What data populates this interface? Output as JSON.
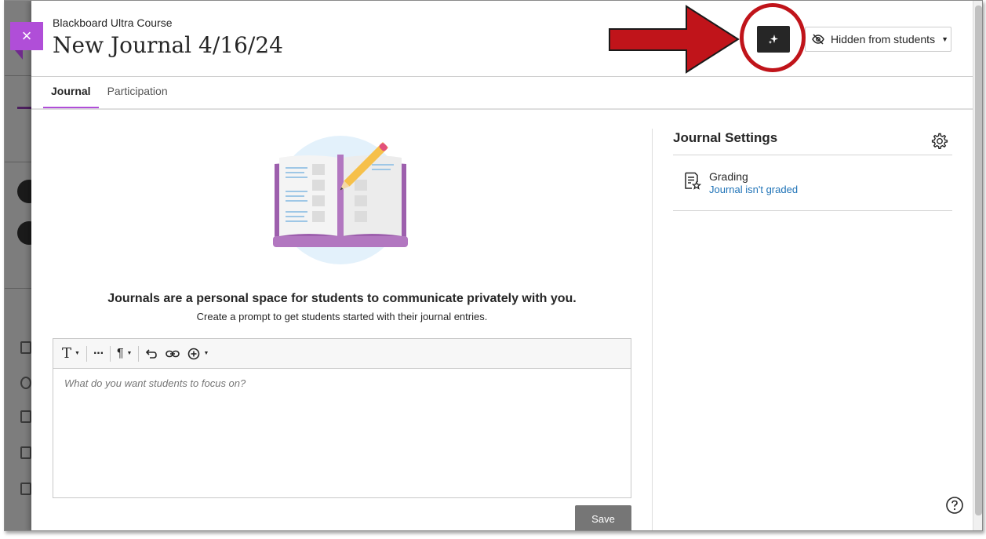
{
  "header": {
    "course_name": "Blackboard Ultra Course",
    "title": "New Journal 4/16/24",
    "close_glyph": "×",
    "visibility_label": "Hidden from students"
  },
  "tabs": [
    {
      "label": "Journal",
      "active": true
    },
    {
      "label": "Participation",
      "active": false
    }
  ],
  "main": {
    "headline": "Journals are a personal space for students to communicate privately with you.",
    "subline": "Create a prompt to get students started with their journal entries.",
    "editor_placeholder": "What do you want students to focus on?",
    "save_label": "Save"
  },
  "settings": {
    "title": "Journal Settings",
    "grading_label": "Grading",
    "grading_value": "Journal isn't graded"
  },
  "colors": {
    "accent": "#b04ed8",
    "link": "#1f73b7",
    "annotation": "#c0141a"
  },
  "icons": [
    "close-icon",
    "ai-sparkle-icon",
    "eye-slash-icon",
    "chevron-down-icon",
    "text-format-icon",
    "more-icon",
    "paragraph-icon",
    "undo-icon",
    "link-icon",
    "insert-content-icon",
    "gear-icon",
    "grading-icon",
    "help-icon"
  ]
}
